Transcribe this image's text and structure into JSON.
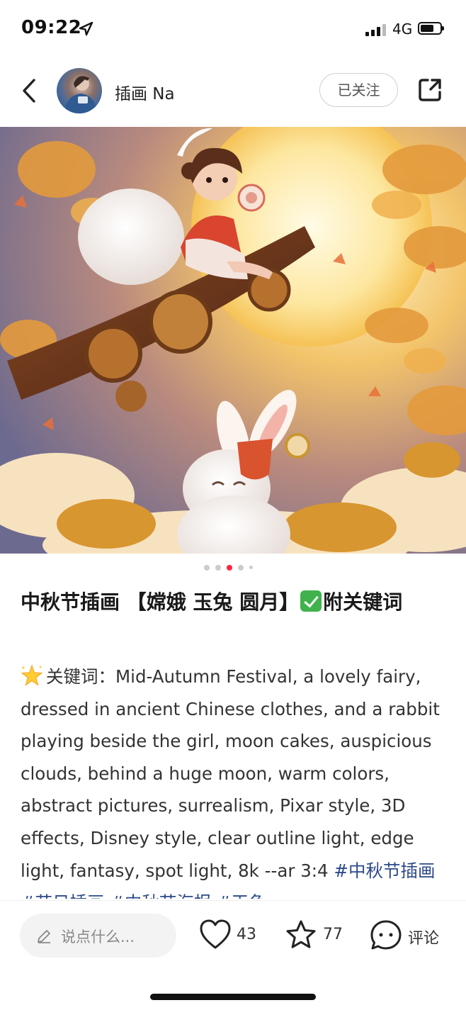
{
  "status_bar": {
    "time": "09:22",
    "network": "4G",
    "location_icon": "location-arrow-icon",
    "signal_icon": "signal-bars-icon",
    "battery_icon": "battery-icon"
  },
  "nav": {
    "back_icon": "chevron-left-icon",
    "username": "插画 Na",
    "follow_label": "已关注",
    "share_icon": "share-icon"
  },
  "carousel": {
    "total": 5,
    "active_index": 2,
    "active_color": "#ff2442",
    "inactive_color": "#cccccc"
  },
  "post": {
    "title_part1": "中秋节插画 【嫦娥 玉兔 圆月】",
    "title_part2": "附关键词",
    "title_emoji": "check-mark-button-icon",
    "keyword_emoji": "glowing-star-icon",
    "body": "关键词：Mid-Autumn Festival, a lovely fairy, dressed in ancient Chinese clothes, and a rabbit playing beside the girl, moon cakes, auspicious clouds, behind a huge moon, warm colors, abstract pictures, surrealism, Pixar style, 3D effects, Disney style, clear outline light, edge light, fantasy, spot light, 8k --ar 3:4",
    "tags": " #中秋节插画 #节日插画 #中秋节海报 #天鱼"
  },
  "bottom_bar": {
    "comment_placeholder": "说点什么...",
    "like_count": "43",
    "collect_count": "77",
    "comment_label": "评论",
    "icons": {
      "pen": "pen-icon",
      "like": "heart-icon",
      "collect": "star-icon",
      "comment": "chat-bubble-icon"
    }
  },
  "colors": {
    "accent": "#ff2442",
    "tag_blue": "#2c4a8a",
    "check_green": "#3fb24c"
  }
}
